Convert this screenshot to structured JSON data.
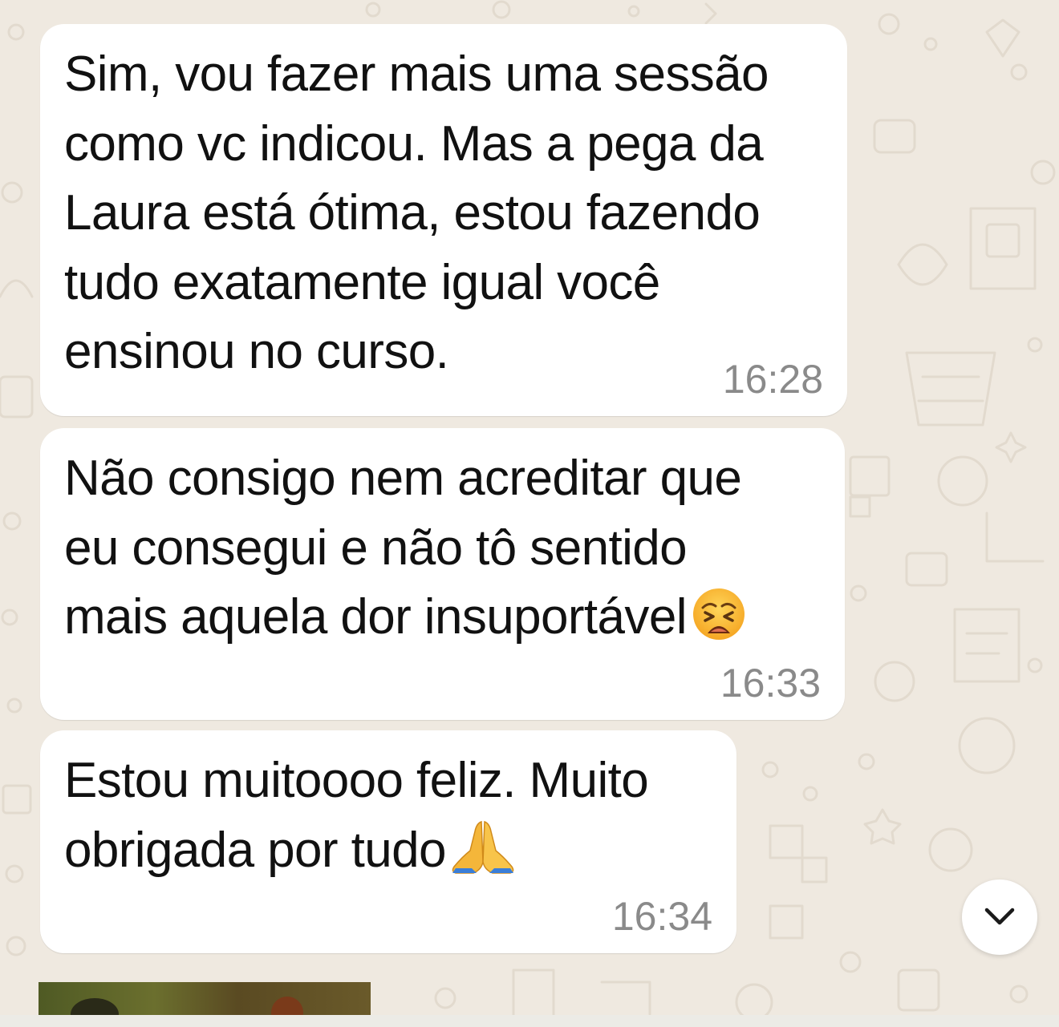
{
  "colors": {
    "background": "#efe9e0",
    "bubble": "#ffffff",
    "text": "#111111",
    "timestamp": "#8a8a8a"
  },
  "messages": [
    {
      "lines": [
        "Sim, vou fazer mais uma sessão",
        "como vc indicou. Mas a pega da",
        "Laura está ótima, estou fazendo",
        "tudo exatamente igual você",
        "ensinou no curso."
      ],
      "time": "16:28"
    },
    {
      "lines": [
        "Não consigo nem acreditar que",
        "eu consegui e não tô sentido",
        "mais aquela dor insuportável"
      ],
      "emoji": "weary-face-emoji",
      "time": "16:33"
    },
    {
      "lines": [
        "Estou muitoooo feliz. Muito",
        "obrigada por tudo"
      ],
      "emoji": "folded-hands-emoji",
      "time": "16:34"
    }
  ],
  "scroll_button": {
    "icon": "chevron-down-icon"
  },
  "media_preview": {
    "icon": "image-thumbnail"
  }
}
